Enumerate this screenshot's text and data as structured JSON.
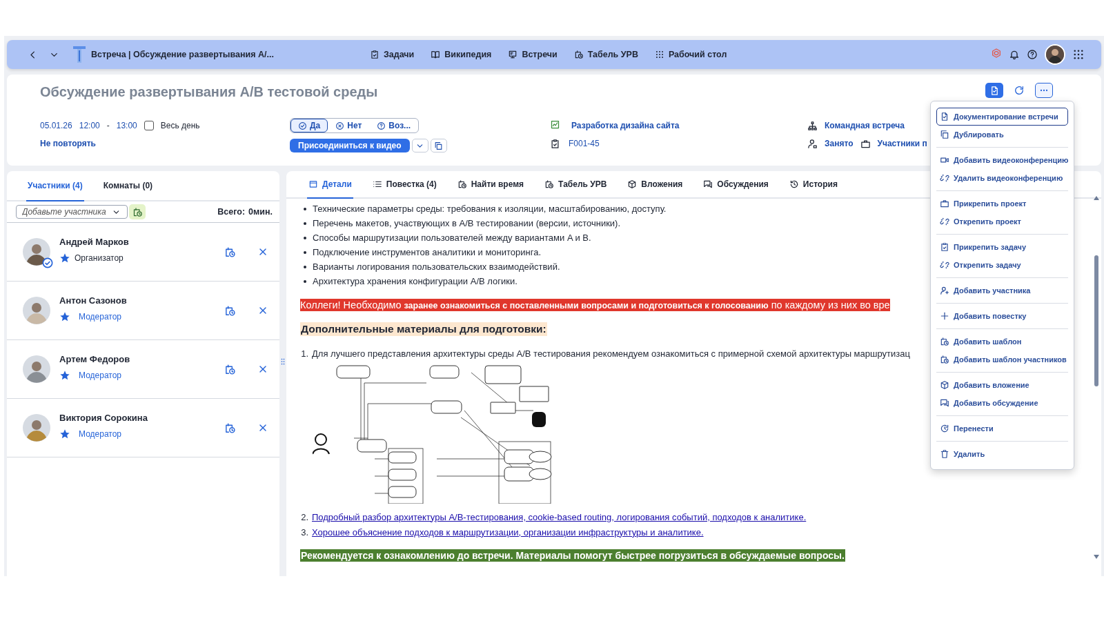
{
  "topbar": {
    "title": "Встреча | Обсуждение развертывания А/...",
    "nav": [
      {
        "label": "Задачи"
      },
      {
        "label": "Википедия"
      },
      {
        "label": "Встречи"
      },
      {
        "label": "Табель УРВ"
      },
      {
        "label": "Рабочий стол"
      }
    ]
  },
  "meeting": {
    "title": "Обсуждение развертывания A/B тестовой среды",
    "date": "05.01.26",
    "start": "12:00",
    "separator": "-",
    "end": "13:00",
    "all_day": {
      "label": "Весь день",
      "checked": false
    },
    "repeat": "Не повторять",
    "rsvp": [
      {
        "label": "Да",
        "selected": true
      },
      {
        "label": "Нет",
        "selected": false
      },
      {
        "label": "Воз...",
        "selected": false
      }
    ],
    "join_button": "Присоединиться к видео",
    "project": "Разработка дизайна сайта",
    "task": "F001-45",
    "meeting_type": "Командная встреча",
    "busy": "Занято",
    "participants_link": "Участники п"
  },
  "participants_panel": {
    "tabs": [
      {
        "label": "Участники (4)",
        "selected": true
      },
      {
        "label": "Комнаты (0)",
        "selected": false
      }
    ],
    "add_field": {
      "placeholder": "Добавьте участника"
    },
    "total_label": "Всего:",
    "total_value": "0мин.",
    "people": [
      {
        "name": "Андрей Марков",
        "role": "Организатор",
        "kind": "organizer",
        "confirmed": true
      },
      {
        "name": "Антон Сазонов",
        "role": "Модератор",
        "kind": "moderator",
        "confirmed": false
      },
      {
        "name": "Артем Федоров",
        "role": "Модератор",
        "kind": "moderator",
        "confirmed": false
      },
      {
        "name": "Виктория Сорокина",
        "role": "Модератор",
        "kind": "moderator",
        "confirmed": false
      }
    ]
  },
  "content": {
    "tabs": [
      {
        "label": "Детали",
        "selected": true
      },
      {
        "label": "Повестка (4)",
        "selected": false
      },
      {
        "label": "Найти время",
        "selected": false
      },
      {
        "label": "Табель УРВ",
        "selected": false
      },
      {
        "label": "Вложения",
        "selected": false
      },
      {
        "label": "Обсуждения",
        "selected": false
      },
      {
        "label": "История",
        "selected": false
      }
    ],
    "bullets": [
      "Технические параметры среды: требования к изоляции, масштабированию, доступу.",
      "Перечень макетов, участвующих в A/B тестировании (версии, источники).",
      "Способы маршрутизации пользователей между вариантами A и B.",
      "Подключение инструментов аналитики и мониторинга.",
      "Варианты логирования пользовательских взаимодействий.",
      "Архитектура хранения конфигурации A/B логики."
    ],
    "alert": "Коллеги! Необходимо **заранее ознакомиться с поставленными вопросами и подготовиться к голосованию** по каждому из них во вре",
    "heading": "Дополнительные материалы для подготовки:",
    "materials": [
      {
        "number": "1.",
        "text": "Для лучшего представления архитектуры среды A/B тестирования рекомендуем ознакомиться с примерной схемой архитектуры маршрутизац",
        "kind": "text"
      },
      {
        "number": "2.",
        "text": "Подробный разбор архитектуры A/B-тестирования, cookie-based routing, логирования событий, подходов к аналитике.",
        "kind": "link"
      },
      {
        "number": "3.",
        "text": "Хорошее объяснение подходов к маршрутизации, организации инфраструктуры и аналитике.",
        "kind": "link"
      }
    ],
    "diagram": {
      "kind": "picture"
    },
    "note": "Рекомендуется к ознакомлению до встречи. Материалы помогут быстрее погрузиться в обсуждаемые вопросы."
  },
  "menu": {
    "groups": [
      [
        {
          "label": "Документирование встречи",
          "selected": true
        },
        {
          "label": "Дублировать",
          "selected": false
        }
      ],
      [
        {
          "label": "Добавить видеоконференцию",
          "selected": false
        },
        {
          "label": "Удалить видеоконференцию",
          "selected": false
        }
      ],
      [
        {
          "label": "Прикрепить проект",
          "selected": false
        },
        {
          "label": "Открепить проект",
          "selected": false
        }
      ],
      [
        {
          "label": "Прикрепить задачу",
          "selected": false
        },
        {
          "label": "Открепить задачу",
          "selected": false
        }
      ],
      [
        {
          "label": "Добавить участника",
          "selected": false
        }
      ],
      [
        {
          "label": "Добавить повестку",
          "selected": false
        }
      ],
      [
        {
          "label": "Добавить шаблон",
          "selected": false
        },
        {
          "label": "Добавить шаблон участников",
          "selected": false
        }
      ],
      [
        {
          "label": "Добавить вложение",
          "selected": false
        },
        {
          "label": "Добавить обсуждение",
          "selected": false
        }
      ],
      [
        {
          "label": "Перенести",
          "selected": false
        }
      ],
      [
        {
          "label": "Удалить",
          "selected": false
        }
      ]
    ]
  }
}
